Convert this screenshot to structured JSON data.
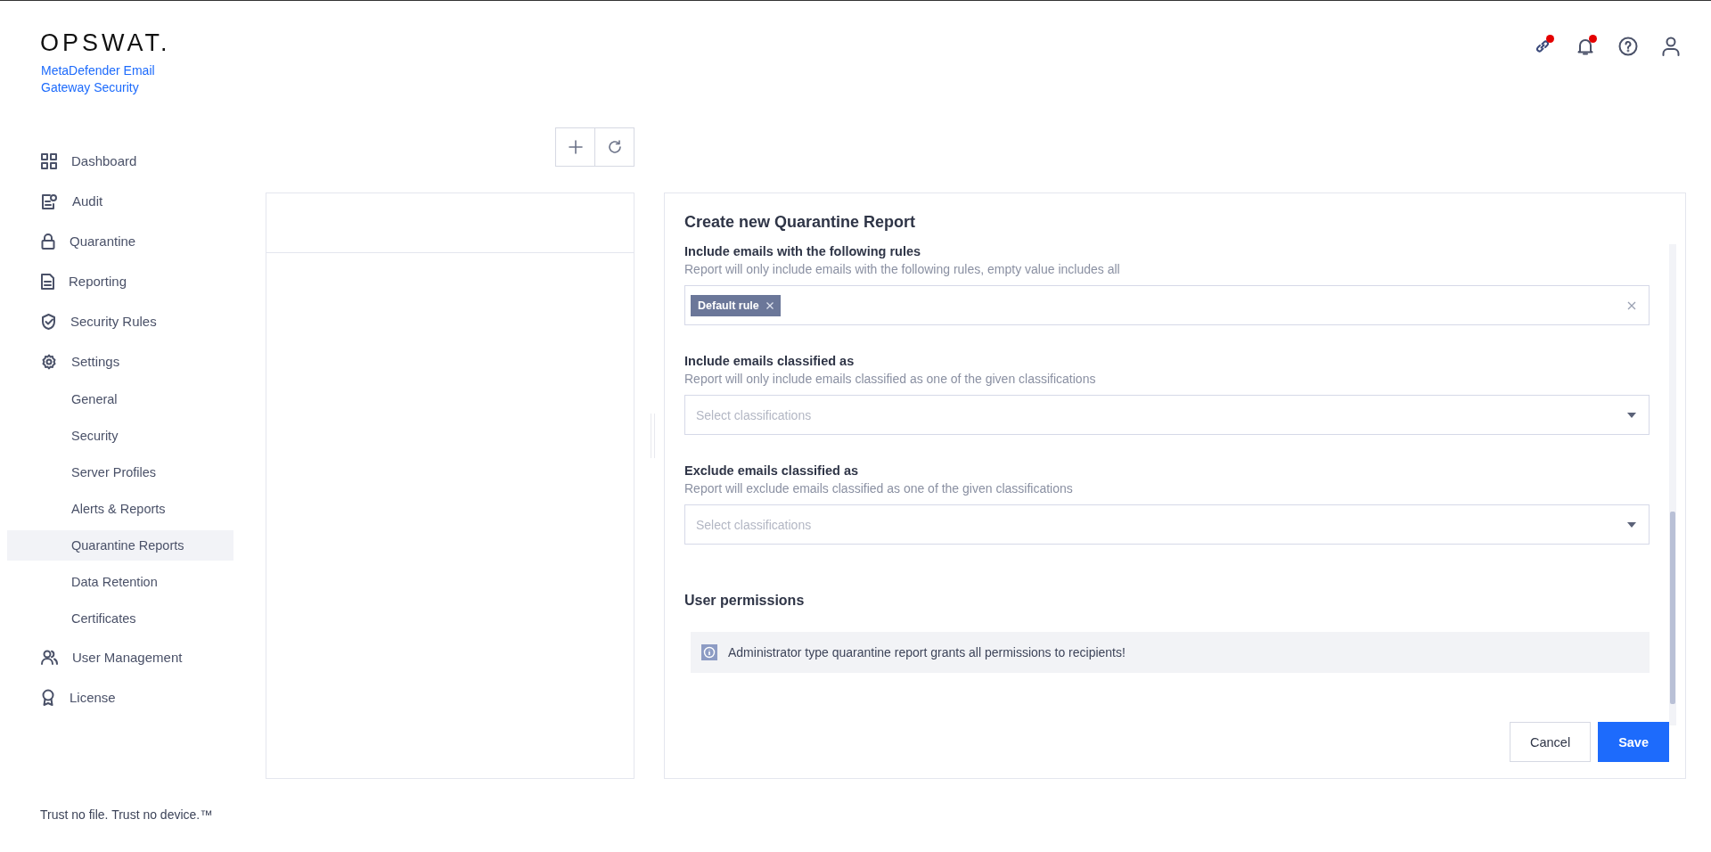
{
  "brand": {
    "logo": "OPSWAT.",
    "product": "MetaDefender Email Gateway Security"
  },
  "header_icons": [
    {
      "kind": "link",
      "badge": true
    },
    {
      "kind": "bell",
      "badge": true
    },
    {
      "kind": "help",
      "badge": false
    },
    {
      "kind": "user",
      "badge": false
    }
  ],
  "sidebar": {
    "items": [
      {
        "label": "Dashboard",
        "selected": false
      },
      {
        "label": "Audit",
        "selected": false
      },
      {
        "label": "Quarantine",
        "selected": false
      },
      {
        "label": "Reporting",
        "selected": false
      },
      {
        "label": "Security Rules",
        "selected": false
      },
      {
        "label": "Settings",
        "selected": false,
        "children": [
          {
            "label": "General",
            "selected": false
          },
          {
            "label": "Security",
            "selected": false
          },
          {
            "label": "Server Profiles",
            "selected": false
          },
          {
            "label": "Alerts & Reports",
            "selected": false
          },
          {
            "label": "Quarantine Reports",
            "selected": true
          },
          {
            "label": "Data Retention",
            "selected": false
          },
          {
            "label": "Certificates",
            "selected": false
          }
        ]
      },
      {
        "label": "User Management",
        "selected": false
      },
      {
        "label": "License",
        "selected": false
      }
    ]
  },
  "footer": "Trust no file. Trust no device.™",
  "form": {
    "title": "Create new Quarantine Report",
    "fields": [
      {
        "kind": "tags",
        "label": "Include emails with the following rules",
        "hint": "Report will only include emails with the following rules, empty value includes all",
        "tags": [
          "Default rule"
        ]
      },
      {
        "kind": "select",
        "label": "Include emails classified as",
        "hint": "Report will only include emails classified as one of the given classifications",
        "placeholder": "Select classifications"
      },
      {
        "kind": "select",
        "label": "Exclude emails classified as",
        "hint": "Report will exclude emails classified as one of the given classifications",
        "placeholder": "Select classifications"
      }
    ],
    "section": "User permissions",
    "notice": "Administrator type quarantine report grants all permissions to recipients!",
    "buttons": [
      {
        "label": "Cancel",
        "kind": "secondary"
      },
      {
        "label": "Save",
        "kind": "primary"
      }
    ]
  }
}
